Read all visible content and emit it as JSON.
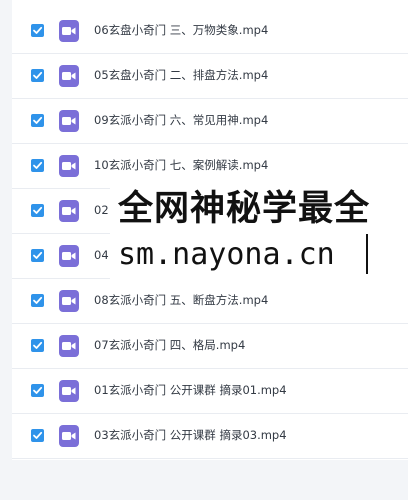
{
  "files": [
    {
      "name": "06玄盘小奇门 三、万物类象.mp4",
      "checked": true
    },
    {
      "name": "05玄盘小奇门 二、排盘方法.mp4",
      "checked": true
    },
    {
      "name": "09玄派小奇门 六、常见用神.mp4",
      "checked": true
    },
    {
      "name": "10玄派小奇门 七、案例解读.mp4",
      "checked": true
    },
    {
      "name": "02",
      "checked": true
    },
    {
      "name": "04",
      "checked": true
    },
    {
      "name": "08玄派小奇门 五、断盘方法.mp4",
      "checked": true
    },
    {
      "name": "07玄派小奇门 四、格局.mp4",
      "checked": true
    },
    {
      "name": "01玄派小奇门 公开课群 摘录01.mp4",
      "checked": true
    },
    {
      "name": "03玄派小奇门 公开课群 摘录03.mp4",
      "checked": true
    }
  ],
  "watermark": {
    "line1": "全网神秘学最全",
    "line2": "sm.nayona.cn"
  },
  "colors": {
    "checkbox": "#2f93ea",
    "video_icon": "#7b6fd8",
    "row_divider": "#e9ecf1"
  }
}
